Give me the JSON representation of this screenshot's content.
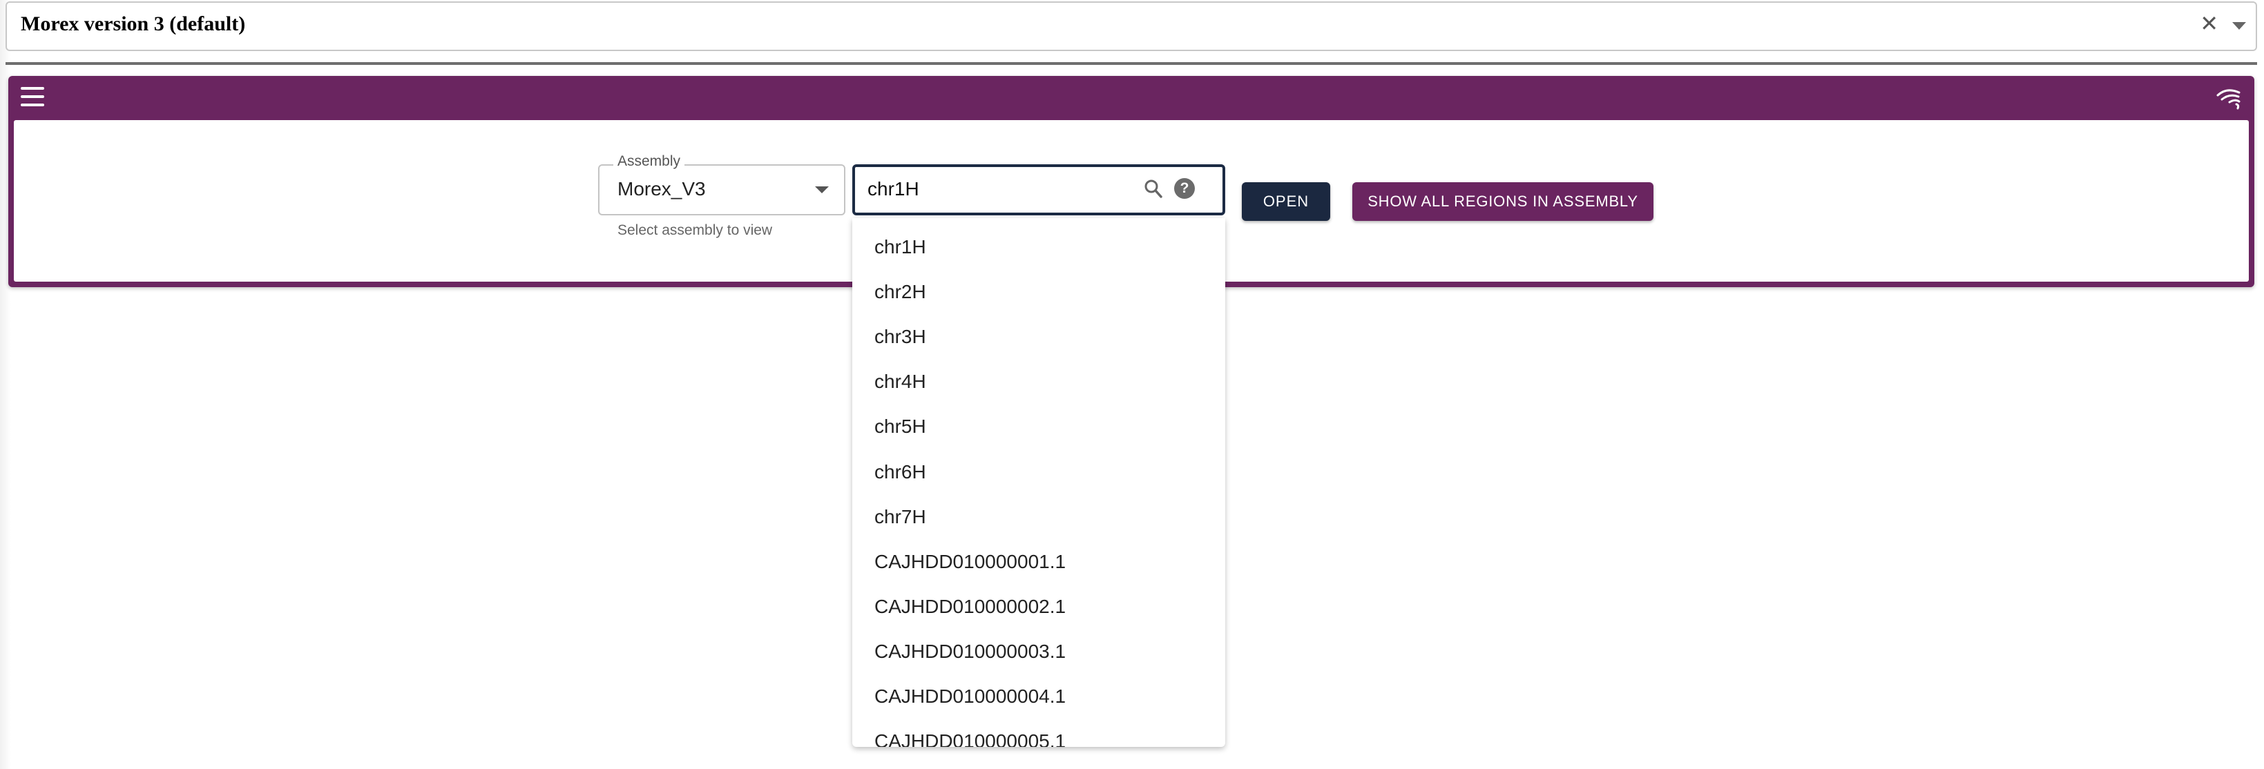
{
  "session": {
    "title": "Morex version 3 (default)"
  },
  "assembly": {
    "label": "Assembly",
    "value": "Morex_V3",
    "helper": "Select assembly to view"
  },
  "search": {
    "value": "chr1H"
  },
  "buttons": {
    "open": "OPEN",
    "show_all": "SHOW ALL REGIONS IN ASSEMBLY"
  },
  "dropdown": {
    "items": [
      "chr1H",
      "chr2H",
      "chr3H",
      "chr4H",
      "chr5H",
      "chr6H",
      "chr7H",
      "CAJHDD010000001.1",
      "CAJHDD010000002.1",
      "CAJHDD010000003.1",
      "CAJHDD010000004.1",
      "CAJHDD010000005.1"
    ]
  },
  "colors": {
    "panel": "#6a2560",
    "open_button": "#1b2840",
    "search_border": "#1c2b44"
  },
  "icons": {
    "menu": "hamburger-menu-icon",
    "logo": "jbrowse-logo-icon",
    "clear": "close-icon",
    "search": "search-icon",
    "help": "help-icon"
  }
}
